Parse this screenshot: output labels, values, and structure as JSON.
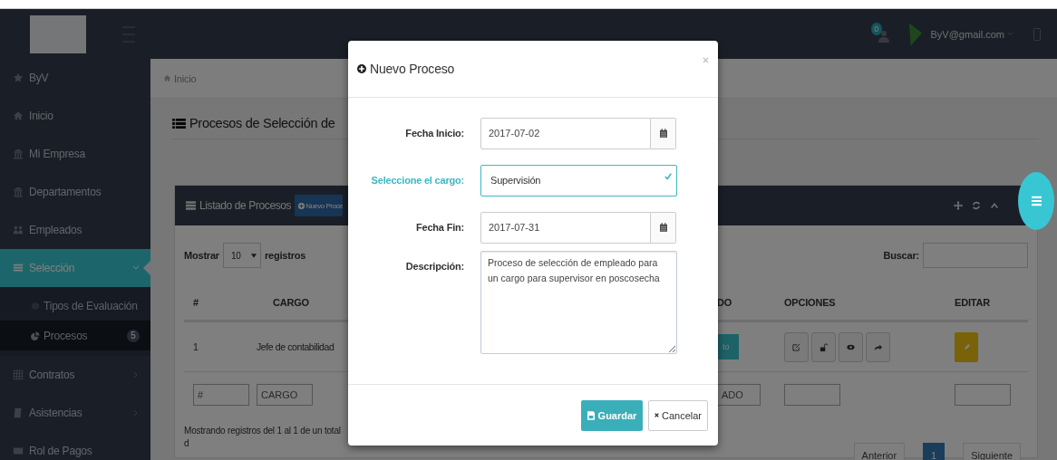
{
  "topbar": {
    "notifications": "0",
    "user": "ByV@gmail.com"
  },
  "sidebar": {
    "items": [
      {
        "label": "ByV",
        "selected": false
      },
      {
        "label": "Inicio",
        "selected": false
      },
      {
        "label": "Mi Empresa",
        "selected": false
      },
      {
        "label": "Departamentos",
        "selected": false
      },
      {
        "label": "Empleados",
        "selected": false
      },
      {
        "label": "Selección",
        "selected": true,
        "expanded": true,
        "children": [
          {
            "label": "Tipos de Evaluación",
            "selected": false
          },
          {
            "label": "Procesos",
            "selected": true,
            "badge": "5"
          }
        ]
      },
      {
        "label": "Contratos",
        "selected": false,
        "expanded": false
      },
      {
        "label": "Asistencias",
        "selected": false,
        "expanded": false
      },
      {
        "label": "Rol de Pagos",
        "selected": false
      }
    ]
  },
  "breadcrumb": "Inicio",
  "page_title": "Procesos de Selección de",
  "panel": {
    "title": "Listado de Procesos",
    "new_button": "Nuevo Proce",
    "length_prefix": "Mostrar",
    "length_value": "10",
    "length_suffix": "registros",
    "search_label": "Buscar:",
    "columns": [
      "#",
      "CARGO",
      "DO",
      "OPCIONES",
      "EDITAR"
    ],
    "rows": [
      {
        "number": "1",
        "cargo": "Jefe de contabilidad",
        "status": "to"
      }
    ],
    "filters": [
      {
        "placeholder": "#"
      },
      {
        "placeholder": "CARGO"
      },
      {
        "placeholder": "ADO"
      }
    ],
    "info": "Mostrando registros del 1 al 1 de un total d",
    "pagination": {
      "previous": "Anterior",
      "pages": [
        {
          "label": "1",
          "selected": true
        }
      ],
      "next": "Siguiente"
    }
  },
  "modal": {
    "title": "Nuevo Proceso",
    "fields": [
      {
        "kind": "date",
        "label": "Fecha Inicio:",
        "value": "2017-07-02"
      },
      {
        "kind": "select",
        "label": "Seleccione el cargo:",
        "value": "Supervisión",
        "valid": true
      },
      {
        "kind": "date",
        "label": "Fecha Fin:",
        "value": "2017-07-31"
      },
      {
        "kind": "textarea",
        "label": "Descripción:",
        "value": "Proceso de selección de empleado para  un cargo para supervisor en poscosecha"
      }
    ],
    "save": "Guardar",
    "cancel": "Cancelar"
  }
}
